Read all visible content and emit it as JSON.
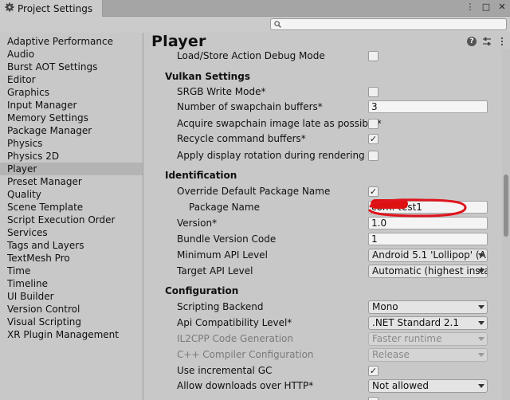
{
  "window": {
    "tab_title": "Project Settings",
    "controls": [
      "⋮",
      "□",
      "✕"
    ]
  },
  "search": {
    "placeholder": ""
  },
  "sidebar": {
    "items": [
      "Adaptive Performance",
      "Audio",
      "Burst AOT Settings",
      "Editor",
      "Graphics",
      "Input Manager",
      "Memory Settings",
      "Package Manager",
      "Physics",
      "Physics 2D",
      "Player",
      "Preset Manager",
      "Quality",
      "Scene Template",
      "Script Execution Order",
      "Services",
      "Tags and Layers",
      "TextMesh Pro",
      "Time",
      "Timeline",
      "UI Builder",
      "Version Control",
      "Visual Scripting",
      "XR Plugin Management"
    ],
    "selected": "Player"
  },
  "main": {
    "title": "Player",
    "icons": [
      "help-icon",
      "sliders-icon",
      "more-icon"
    ],
    "load_store_label": "Load/Store Action Debug Mode",
    "vulkan": {
      "heading": "Vulkan Settings",
      "srgb_label": "SRGB Write Mode*",
      "swapchain_label": "Number of swapchain buffers*",
      "swapchain_value": "3",
      "acquire_label": "Acquire swapchain image late as possible*",
      "recycle_label": "Recycle command buffers*",
      "recycle_check": "✓",
      "rotation_label": "Apply display rotation during rendering"
    },
    "identification": {
      "heading": "Identification",
      "override_label": "Override Default Package Name",
      "override_check": "✓",
      "package_label": "Package Name",
      "package_value": "com.        test1",
      "version_label": "Version*",
      "version_value": "1.0",
      "bundle_label": "Bundle Version Code",
      "bundle_value": "1",
      "min_api_label": "Minimum API Level",
      "min_api_value": "Android 5.1 'Lollipop' (A",
      "target_api_label": "Target API Level",
      "target_api_value": "Automatic (highest insta"
    },
    "configuration": {
      "heading": "Configuration",
      "backend_label": "Scripting Backend",
      "backend_value": "Mono",
      "api_compat_label": "Api Compatibility Level*",
      "api_compat_value": ".NET Standard 2.1",
      "il2cpp_label": "IL2CPP Code Generation",
      "il2cpp_value": "Faster runtime",
      "cpp_label": "C++ Compiler Configuration",
      "cpp_value": "Release",
      "incremental_label": "Use incremental GC",
      "incremental_check": "✓",
      "http_label": "Allow downloads over HTTP*",
      "http_value": "Not allowed"
    }
  }
}
